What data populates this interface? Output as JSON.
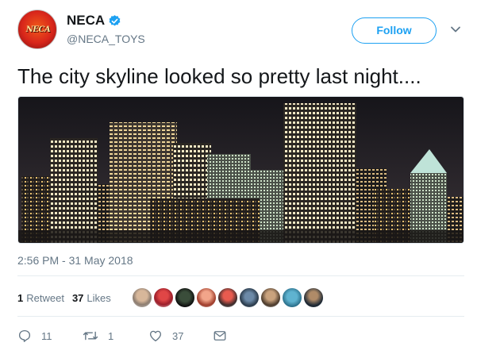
{
  "user": {
    "display_name": "NECA",
    "handle": "@NECA_TOYS",
    "avatar_logo_text": "NECA"
  },
  "follow_label": "Follow",
  "tweet": {
    "text": "The city skyline looked so pretty last night....",
    "timestamp": "2:56 PM - 31 May 2018"
  },
  "stats": {
    "retweets_count": "1",
    "retweets_label": "Retweet",
    "likes_count": "37",
    "likes_label": "Likes"
  },
  "likers_count": 9,
  "actions": {
    "replies": "11",
    "retweets": "1",
    "likes": "37"
  },
  "colors": {
    "accent": "#1da1f2",
    "text": "#14171a",
    "muted": "#657786",
    "divider": "#e6ecf0"
  },
  "icons": {
    "verified": "verified-badge-icon",
    "caret": "chevron-down-icon",
    "reply": "reply-icon",
    "retweet": "retweet-icon",
    "like": "heart-icon",
    "dm": "envelope-icon"
  }
}
